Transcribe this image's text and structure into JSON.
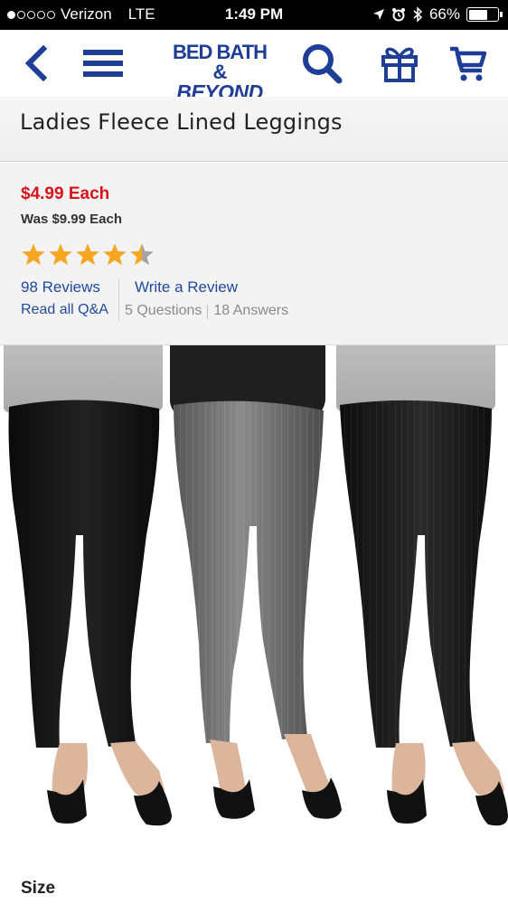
{
  "status_bar": {
    "carrier": "Verizon",
    "network": "LTE",
    "time": "1:49 PM",
    "battery": "66%",
    "battery_level": 0.66
  },
  "nav": {
    "logo_line1": "BED BATH &",
    "logo_line2": "BEYOND",
    "icons": [
      "back-icon",
      "menu-icon",
      "search-icon",
      "gift-icon",
      "cart-icon"
    ]
  },
  "product": {
    "title": "Ladies Fleece Lined Leggings",
    "price": "$4.99 Each",
    "was_price": "Was $9.99 Each",
    "rating": 4.5,
    "rating_max": 5,
    "reviews_label": "98 Reviews",
    "write_review_label": "Write a Review",
    "qa_label": "Read all Q&A",
    "questions_label": "5 Questions",
    "answers_label": "18 Answers",
    "size_label": "Size"
  },
  "colors": {
    "brand_blue": "#1d3d96",
    "link_blue": "#1f4a9e",
    "price_red": "#d8131a",
    "star_gold": "#f5a623",
    "star_gray": "#a3a3a3"
  }
}
